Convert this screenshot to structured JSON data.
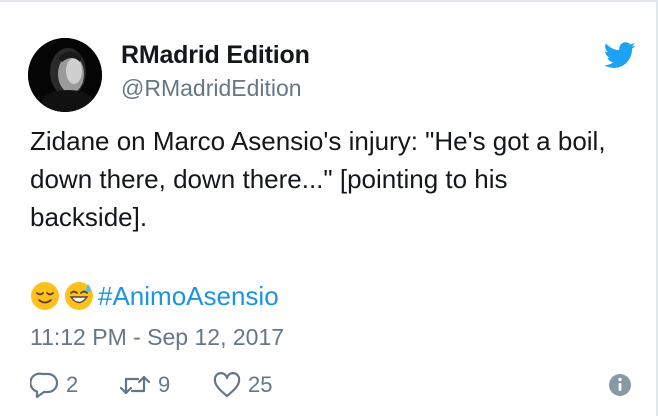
{
  "tweet": {
    "display_name": "RMadrid Edition",
    "handle": "@RMadridEdition",
    "text": "Zidane on Marco Asensio's injury: \"He's got a boil, down there, down there...\" [pointing to his backside].",
    "emojis": [
      "relieved-face-emoji",
      "grinning-sweat-face-emoji"
    ],
    "hashtag": "#AnimoAsensio",
    "timestamp": "11:12 PM - Sep 12, 2017"
  },
  "actions": {
    "reply_count": "2",
    "retweet_count": "9",
    "like_count": "25"
  },
  "icons": {
    "brand": "twitter-bird-icon",
    "reply": "reply-icon",
    "retweet": "retweet-icon",
    "like": "heart-icon",
    "info": "info-icon"
  },
  "colors": {
    "brand_blue": "#1da1f2",
    "hashtag_blue": "#1b95e0",
    "secondary_text": "#657786",
    "primary_text": "#14171a"
  }
}
